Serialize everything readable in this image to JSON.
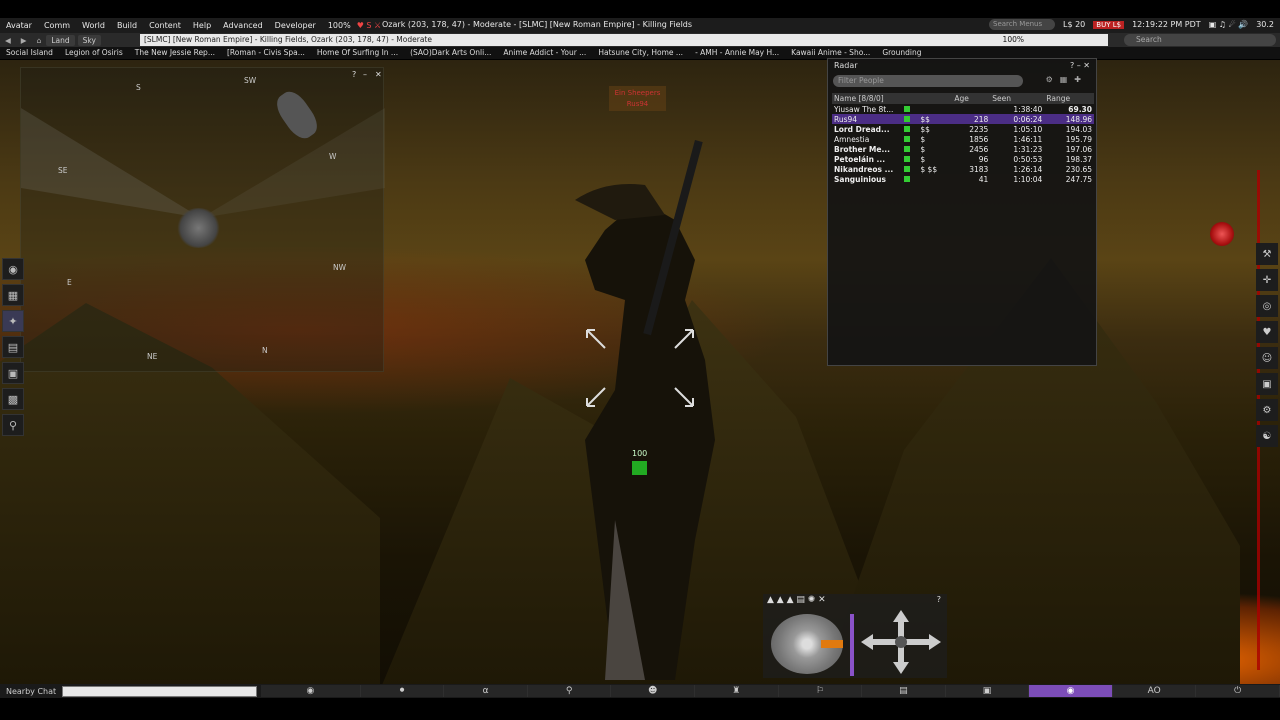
{
  "menubar": {
    "items": [
      "Avatar",
      "Comm",
      "World",
      "Build",
      "Content",
      "Help",
      "Advanced",
      "Developer"
    ],
    "volume": "100%",
    "status": "Ozark (203, 178, 47) - Moderate - [SLMC] [New Roman Empire] - Killing Fields",
    "search_placeholder": "Search Menus",
    "balance": "L$ 20",
    "buy_label": "BUY L$",
    "time": "12:19:22 PM PDT",
    "fps": "30.2"
  },
  "navbar": {
    "land": "Land",
    "sky": "Sky",
    "location": "[SLMC] [New Roman Empire] - Killing Fields, Ozark (203, 178, 47) - Moderate",
    "zoom": "100%",
    "search_placeholder": "Search"
  },
  "favorites": [
    "Social Island",
    "Legion of Osiris",
    "The New Jessie Rep...",
    "[Roman - Civis Spa...",
    "Home Of Surfing In ...",
    "(SAO)Dark Arts Onli...",
    "Anime Addict - Your ...",
    "Hatsune City, Home ...",
    "- AMH - Annie May H...",
    "Kawaii Anime - Sho...",
    "Grounding"
  ],
  "minimap": {
    "compass": {
      "s": "S",
      "sw": "SW",
      "w": "W",
      "se": "SE",
      "e": "E",
      "nw": "NW",
      "ne": "NE",
      "n": "N"
    },
    "help": "?",
    "minimize": "–",
    "close": "✕"
  },
  "hover_tag": [
    "Ein Sheepers",
    "Rus94"
  ],
  "health": "100",
  "radar": {
    "title": "Radar",
    "filter_placeholder": "Filter People",
    "columns": {
      "name": "Name [8/8/0]",
      "age": "Age",
      "seen": "Seen",
      "range": "Range"
    },
    "rows": [
      {
        "name": "Yiusaw The 8t...",
        "flag": "",
        "age": "",
        "seen": "1:38:40",
        "range": "69.30"
      },
      {
        "name": "Rus94",
        "flag": "$$",
        "age": "218",
        "seen": "0:06:24",
        "range": "148.96"
      },
      {
        "name": "Lord Dread...",
        "flag": "$$",
        "age": "2235",
        "seen": "1:05:10",
        "range": "194.03"
      },
      {
        "name": "Amnestia",
        "flag": "$",
        "age": "1856",
        "seen": "1:46:11",
        "range": "195.79"
      },
      {
        "name": "Brother Me...",
        "flag": "$",
        "age": "2456",
        "seen": "1:31:23",
        "range": "197.06"
      },
      {
        "name": "Petoeláin ...",
        "flag": "$",
        "age": "96",
        "seen": "0:50:53",
        "range": "198.37"
      },
      {
        "name": "Nikandreos ...",
        "flag": "$ $$",
        "age": "3183",
        "seen": "1:26:14",
        "range": "230.65"
      },
      {
        "name": "Sanguinious",
        "flag": "",
        "age": "41",
        "seen": "1:10:04",
        "range": "247.75"
      }
    ]
  },
  "camera": {
    "help": "?"
  },
  "bottombar": {
    "nearby_chat": "Nearby Chat",
    "ao": "AO"
  },
  "colors": {
    "accent_purple": "#7c4db8",
    "radar_selected": "#4b2d85",
    "online_green": "#33cc33"
  }
}
